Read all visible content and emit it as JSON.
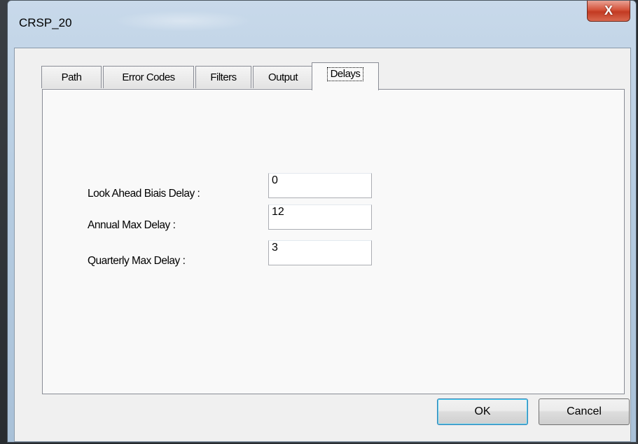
{
  "window": {
    "title": "CRSP_20",
    "close_glyph": "X"
  },
  "tabs": [
    {
      "label": "Path",
      "active": false
    },
    {
      "label": "Error Codes",
      "active": false
    },
    {
      "label": "Filters",
      "active": false
    },
    {
      "label": "Output",
      "active": false
    },
    {
      "label": "Delays",
      "active": true
    }
  ],
  "delays": {
    "look_ahead": {
      "label": "Look Ahead Biais Delay :",
      "value": "0"
    },
    "annual_max": {
      "label": "Annual Max Delay :",
      "value": "12"
    },
    "quarterly_max": {
      "label": "Quarterly Max Delay :",
      "value": "3"
    }
  },
  "buttons": {
    "ok_label": "OK",
    "cancel_label": "Cancel"
  },
  "colors": {
    "close_button": "#c23a22",
    "default_button_border": "#3c7fb1"
  }
}
